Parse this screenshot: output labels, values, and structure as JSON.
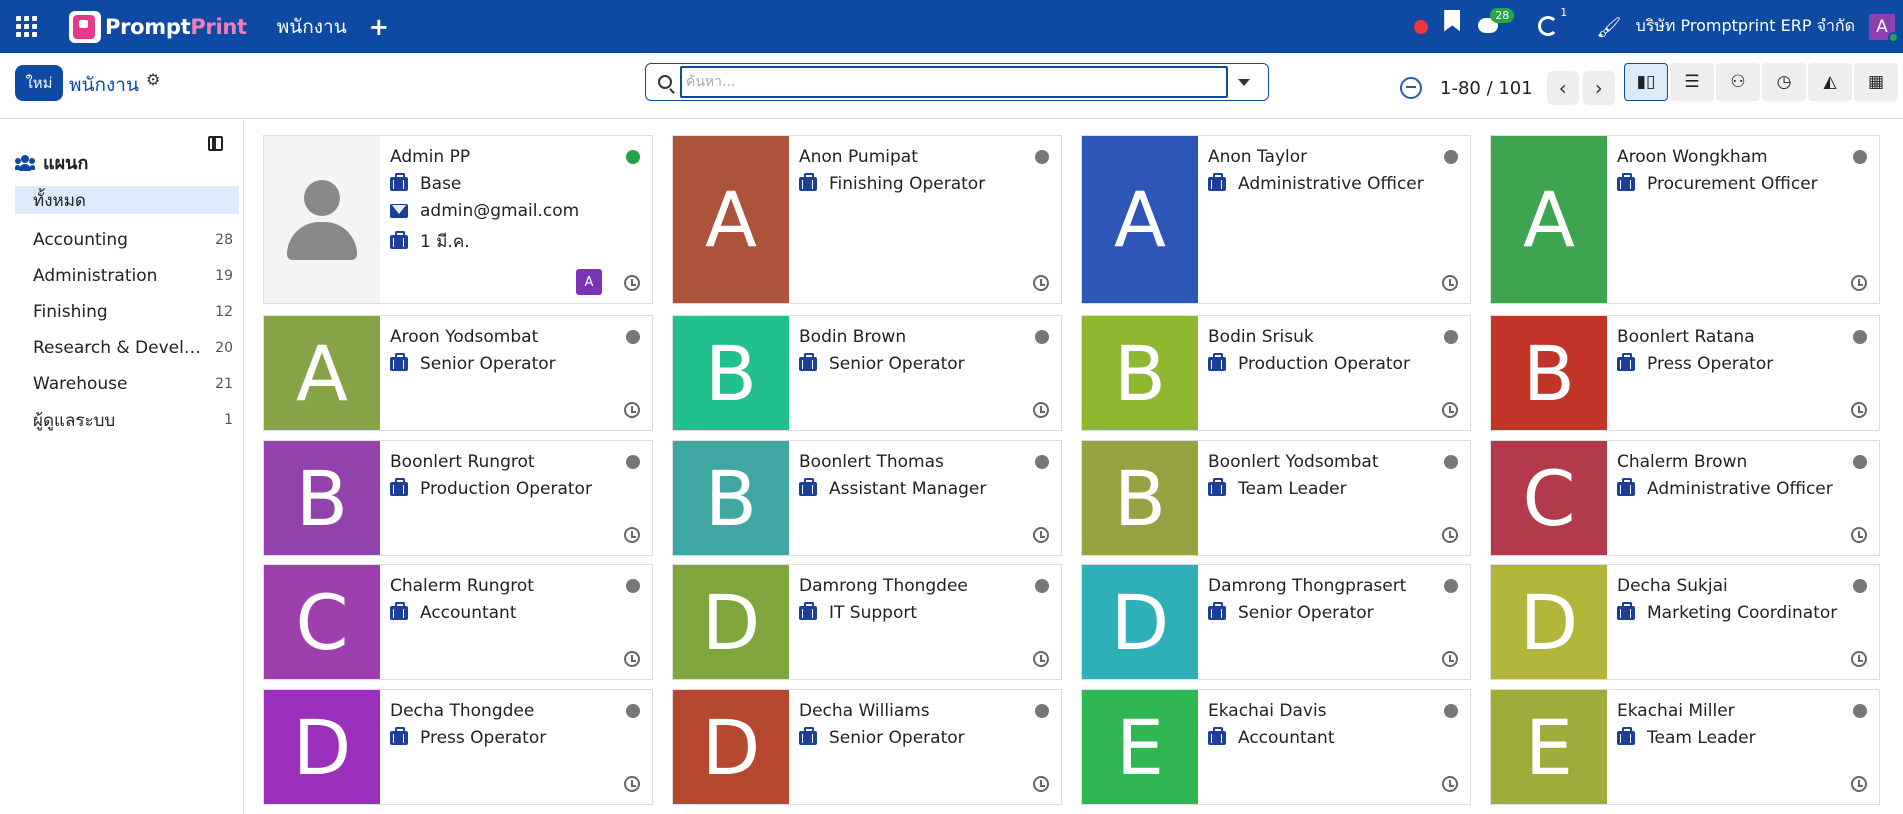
{
  "navbar": {
    "logo_a": "Prompt",
    "logo_b": "Print",
    "menu": "พนักงาน",
    "plus": "+",
    "messages_count": "28",
    "activity_count": "1",
    "company": "บริษัท Promptprint ERP จำกัด",
    "user_initial": "A"
  },
  "control": {
    "new_label": "ใหม่",
    "breadcrumb": "พนักงาน",
    "search_placeholder": "ค้นหา...",
    "pager": "1-80 / 101",
    "prev": "‹",
    "next": "›"
  },
  "sidebar": {
    "title": "แผนก",
    "items": [
      {
        "label": "ทั้งหมด",
        "count": ""
      },
      {
        "label": "Accounting",
        "count": "28"
      },
      {
        "label": "Administration",
        "count": "19"
      },
      {
        "label": "Finishing",
        "count": "12"
      },
      {
        "label": "Research & Development",
        "count": "20"
      },
      {
        "label": "Warehouse",
        "count": "21"
      },
      {
        "label": "ผู้ดูแลระบบ",
        "count": "1"
      }
    ]
  },
  "employees": [
    {
      "name": "Admin PP",
      "job": "Base",
      "email": "admin@gmail.com",
      "since": "1 มี.ค.",
      "initial": "",
      "color": "#f4f4f4",
      "online": true,
      "assignee": "A"
    },
    {
      "name": "Anon Pumipat",
      "job": "Finishing Operator",
      "initial": "A",
      "color": "#ac533c"
    },
    {
      "name": "Anon Taylor",
      "job": "Administrative Officer",
      "initial": "A",
      "color": "#2e55b8"
    },
    {
      "name": "Aroon Wongkham",
      "job": "Procurement Officer",
      "initial": "A",
      "color": "#3fa44f"
    },
    {
      "name": "Aroon Yodsombat",
      "job": "Senior Operator",
      "initial": "A",
      "color": "#87a348"
    },
    {
      "name": "Bodin Brown",
      "job": "Senior Operator",
      "initial": "B",
      "color": "#22c08e"
    },
    {
      "name": "Bodin Srisuk",
      "job": "Production Operator",
      "initial": "B",
      "color": "#8db830"
    },
    {
      "name": "Boonlert Ratana",
      "job": "Press Operator",
      "initial": "B",
      "color": "#c23428"
    },
    {
      "name": "Boonlert Rungrot",
      "job": "Production Operator",
      "initial": "B",
      "color": "#9242ab"
    },
    {
      "name": "Boonlert Thomas",
      "job": "Assistant Manager",
      "initial": "B",
      "color": "#3fa6a1"
    },
    {
      "name": "Boonlert Yodsombat",
      "job": "Team Leader",
      "initial": "B",
      "color": "#98a243"
    },
    {
      "name": "Chalerm Brown",
      "job": "Administrative Officer",
      "initial": "C",
      "color": "#b33a4a"
    },
    {
      "name": "Chalerm Rungrot",
      "job": "Accountant",
      "initial": "C",
      "color": "#9e3fb0"
    },
    {
      "name": "Damrong Thongdee",
      "job": "IT Support",
      "initial": "D",
      "color": "#7ea63c"
    },
    {
      "name": "Damrong Thongprasert",
      "job": "Senior Operator",
      "initial": "D",
      "color": "#2fb0b8"
    },
    {
      "name": "Decha Sukjai",
      "job": "Marketing Coordinator",
      "initial": "D",
      "color": "#b3b43a"
    },
    {
      "name": "Decha Thongdee",
      "job": "Press Operator",
      "initial": "D",
      "color": "#9a2fbc"
    },
    {
      "name": "Decha Williams",
      "job": "Senior Operator",
      "initial": "D",
      "color": "#b5482e"
    },
    {
      "name": "Ekachai Davis",
      "job": "Accountant",
      "initial": "E",
      "color": "#30b653"
    },
    {
      "name": "Ekachai Miller",
      "job": "Team Leader",
      "initial": "E",
      "color": "#9fac3c"
    }
  ]
}
